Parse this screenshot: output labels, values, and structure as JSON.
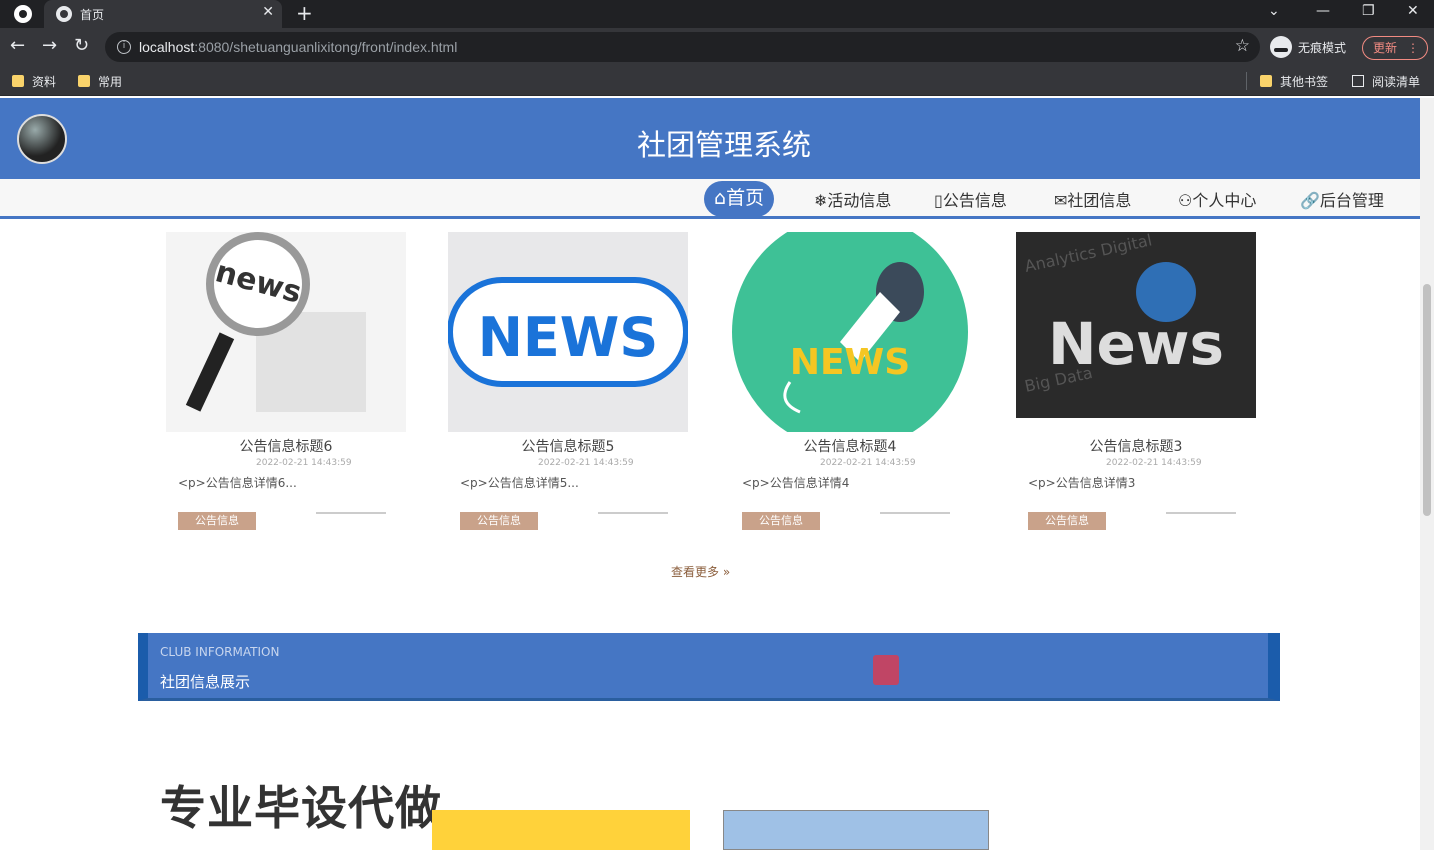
{
  "browser": {
    "tab_title": "首页",
    "url_host": "localhost",
    "url_path": ":8080/shetuanguanlixitong/front/index.html",
    "incognito_label": "无痕模式",
    "update_label": "更新",
    "bookmarks": [
      "资料",
      "常用"
    ],
    "bookmarks_right": [
      "其他书签",
      "阅读清单"
    ]
  },
  "site": {
    "title": "社团管理系统",
    "nav": [
      {
        "icon": "⌂",
        "label": "首页",
        "active": true
      },
      {
        "icon": "❄",
        "label": "活动信息"
      },
      {
        "icon": "▯",
        "label": "公告信息"
      },
      {
        "icon": "✉",
        "label": "社团信息"
      },
      {
        "icon": "⚇",
        "label": "个人中心"
      },
      {
        "icon": "🔗",
        "label": "后台管理"
      }
    ]
  },
  "news": [
    {
      "title": "公告信息标题6",
      "date": "2022-02-21 14:43:59",
      "desc": "<p>公告信息详情6...",
      "button": "公告信息"
    },
    {
      "title": "公告信息标题5",
      "date": "2022-02-21 14:43:59",
      "desc": "<p>公告信息详情5...",
      "button": "公告信息"
    },
    {
      "title": "公告信息标题4",
      "date": "2022-02-21 14:43:59",
      "desc": "<p>公告信息详情4",
      "button": "公告信息"
    },
    {
      "title": "公告信息标题3",
      "date": "2022-02-21 14:43:59",
      "desc": "<p>公告信息详情3",
      "button": "公告信息"
    }
  ],
  "more_label": "查看更多",
  "banner": {
    "subtitle": "CLUB INFORMATION",
    "title": "社团信息展示"
  },
  "promo_text": "专业毕设代做",
  "colors": {
    "primary": "#4576c4",
    "button": "#c9a28a"
  }
}
